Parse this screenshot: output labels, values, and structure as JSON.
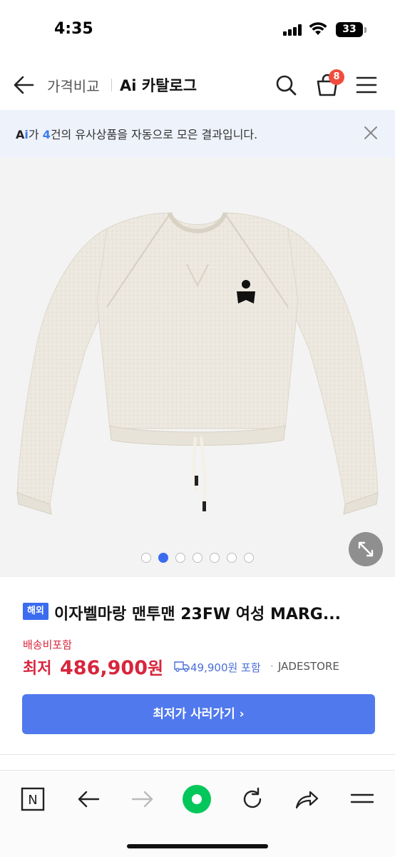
{
  "status_bar": {
    "time": "4:35",
    "battery": "33"
  },
  "header": {
    "compare_label": "가격비교",
    "catalog_label": "Ai 카탈로그",
    "cart_count": "8"
  },
  "ai_banner": {
    "logo_a": "A",
    "logo_i": "i",
    "text_before": "가 ",
    "count": "4",
    "text_after": "건의 유사상품을 자동으로 모은 결과입니다."
  },
  "gallery": {
    "image_count": 7,
    "active_index": 1
  },
  "product": {
    "badge": "해외",
    "title": "이자벨마랑 맨투맨 23FW 여성 MARG...",
    "shipping_included": "배송비포함",
    "price_label": "최저",
    "price": "486,900",
    "price_unit": "원",
    "shipping_fee": "49,900원 포함",
    "separator": "·",
    "store": "JADESTORE"
  },
  "buy_button": {
    "label": "최저가 사러가기 ›"
  },
  "colors": {
    "accent_blue": "#5079ed",
    "price_red": "#d7263d",
    "badge_red": "#f04c3e",
    "naver_green": "#03c75a"
  },
  "browser_bar": {
    "icons": [
      "naver-n-icon",
      "back-arrow-icon",
      "forward-arrow-icon",
      "home-dot-icon",
      "reload-icon",
      "share-icon",
      "menu-icon"
    ],
    "naver_label": "N"
  }
}
